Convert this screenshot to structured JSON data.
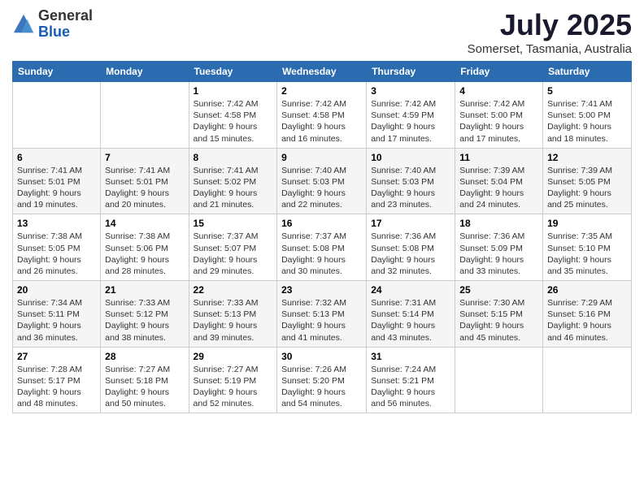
{
  "logo": {
    "general": "General",
    "blue": "Blue"
  },
  "title": "July 2025",
  "subtitle": "Somerset, Tasmania, Australia",
  "days_of_week": [
    "Sunday",
    "Monday",
    "Tuesday",
    "Wednesday",
    "Thursday",
    "Friday",
    "Saturday"
  ],
  "weeks": [
    [
      {
        "day": "",
        "info": ""
      },
      {
        "day": "",
        "info": ""
      },
      {
        "day": "1",
        "info": "Sunrise: 7:42 AM\nSunset: 4:58 PM\nDaylight: 9 hours\nand 15 minutes."
      },
      {
        "day": "2",
        "info": "Sunrise: 7:42 AM\nSunset: 4:58 PM\nDaylight: 9 hours\nand 16 minutes."
      },
      {
        "day": "3",
        "info": "Sunrise: 7:42 AM\nSunset: 4:59 PM\nDaylight: 9 hours\nand 17 minutes."
      },
      {
        "day": "4",
        "info": "Sunrise: 7:42 AM\nSunset: 5:00 PM\nDaylight: 9 hours\nand 17 minutes."
      },
      {
        "day": "5",
        "info": "Sunrise: 7:41 AM\nSunset: 5:00 PM\nDaylight: 9 hours\nand 18 minutes."
      }
    ],
    [
      {
        "day": "6",
        "info": "Sunrise: 7:41 AM\nSunset: 5:01 PM\nDaylight: 9 hours\nand 19 minutes."
      },
      {
        "day": "7",
        "info": "Sunrise: 7:41 AM\nSunset: 5:01 PM\nDaylight: 9 hours\nand 20 minutes."
      },
      {
        "day": "8",
        "info": "Sunrise: 7:41 AM\nSunset: 5:02 PM\nDaylight: 9 hours\nand 21 minutes."
      },
      {
        "day": "9",
        "info": "Sunrise: 7:40 AM\nSunset: 5:03 PM\nDaylight: 9 hours\nand 22 minutes."
      },
      {
        "day": "10",
        "info": "Sunrise: 7:40 AM\nSunset: 5:03 PM\nDaylight: 9 hours\nand 23 minutes."
      },
      {
        "day": "11",
        "info": "Sunrise: 7:39 AM\nSunset: 5:04 PM\nDaylight: 9 hours\nand 24 minutes."
      },
      {
        "day": "12",
        "info": "Sunrise: 7:39 AM\nSunset: 5:05 PM\nDaylight: 9 hours\nand 25 minutes."
      }
    ],
    [
      {
        "day": "13",
        "info": "Sunrise: 7:38 AM\nSunset: 5:05 PM\nDaylight: 9 hours\nand 26 minutes."
      },
      {
        "day": "14",
        "info": "Sunrise: 7:38 AM\nSunset: 5:06 PM\nDaylight: 9 hours\nand 28 minutes."
      },
      {
        "day": "15",
        "info": "Sunrise: 7:37 AM\nSunset: 5:07 PM\nDaylight: 9 hours\nand 29 minutes."
      },
      {
        "day": "16",
        "info": "Sunrise: 7:37 AM\nSunset: 5:08 PM\nDaylight: 9 hours\nand 30 minutes."
      },
      {
        "day": "17",
        "info": "Sunrise: 7:36 AM\nSunset: 5:08 PM\nDaylight: 9 hours\nand 32 minutes."
      },
      {
        "day": "18",
        "info": "Sunrise: 7:36 AM\nSunset: 5:09 PM\nDaylight: 9 hours\nand 33 minutes."
      },
      {
        "day": "19",
        "info": "Sunrise: 7:35 AM\nSunset: 5:10 PM\nDaylight: 9 hours\nand 35 minutes."
      }
    ],
    [
      {
        "day": "20",
        "info": "Sunrise: 7:34 AM\nSunset: 5:11 PM\nDaylight: 9 hours\nand 36 minutes."
      },
      {
        "day": "21",
        "info": "Sunrise: 7:33 AM\nSunset: 5:12 PM\nDaylight: 9 hours\nand 38 minutes."
      },
      {
        "day": "22",
        "info": "Sunrise: 7:33 AM\nSunset: 5:13 PM\nDaylight: 9 hours\nand 39 minutes."
      },
      {
        "day": "23",
        "info": "Sunrise: 7:32 AM\nSunset: 5:13 PM\nDaylight: 9 hours\nand 41 minutes."
      },
      {
        "day": "24",
        "info": "Sunrise: 7:31 AM\nSunset: 5:14 PM\nDaylight: 9 hours\nand 43 minutes."
      },
      {
        "day": "25",
        "info": "Sunrise: 7:30 AM\nSunset: 5:15 PM\nDaylight: 9 hours\nand 45 minutes."
      },
      {
        "day": "26",
        "info": "Sunrise: 7:29 AM\nSunset: 5:16 PM\nDaylight: 9 hours\nand 46 minutes."
      }
    ],
    [
      {
        "day": "27",
        "info": "Sunrise: 7:28 AM\nSunset: 5:17 PM\nDaylight: 9 hours\nand 48 minutes."
      },
      {
        "day": "28",
        "info": "Sunrise: 7:27 AM\nSunset: 5:18 PM\nDaylight: 9 hours\nand 50 minutes."
      },
      {
        "day": "29",
        "info": "Sunrise: 7:27 AM\nSunset: 5:19 PM\nDaylight: 9 hours\nand 52 minutes."
      },
      {
        "day": "30",
        "info": "Sunrise: 7:26 AM\nSunset: 5:20 PM\nDaylight: 9 hours\nand 54 minutes."
      },
      {
        "day": "31",
        "info": "Sunrise: 7:24 AM\nSunset: 5:21 PM\nDaylight: 9 hours\nand 56 minutes."
      },
      {
        "day": "",
        "info": ""
      },
      {
        "day": "",
        "info": ""
      }
    ]
  ]
}
